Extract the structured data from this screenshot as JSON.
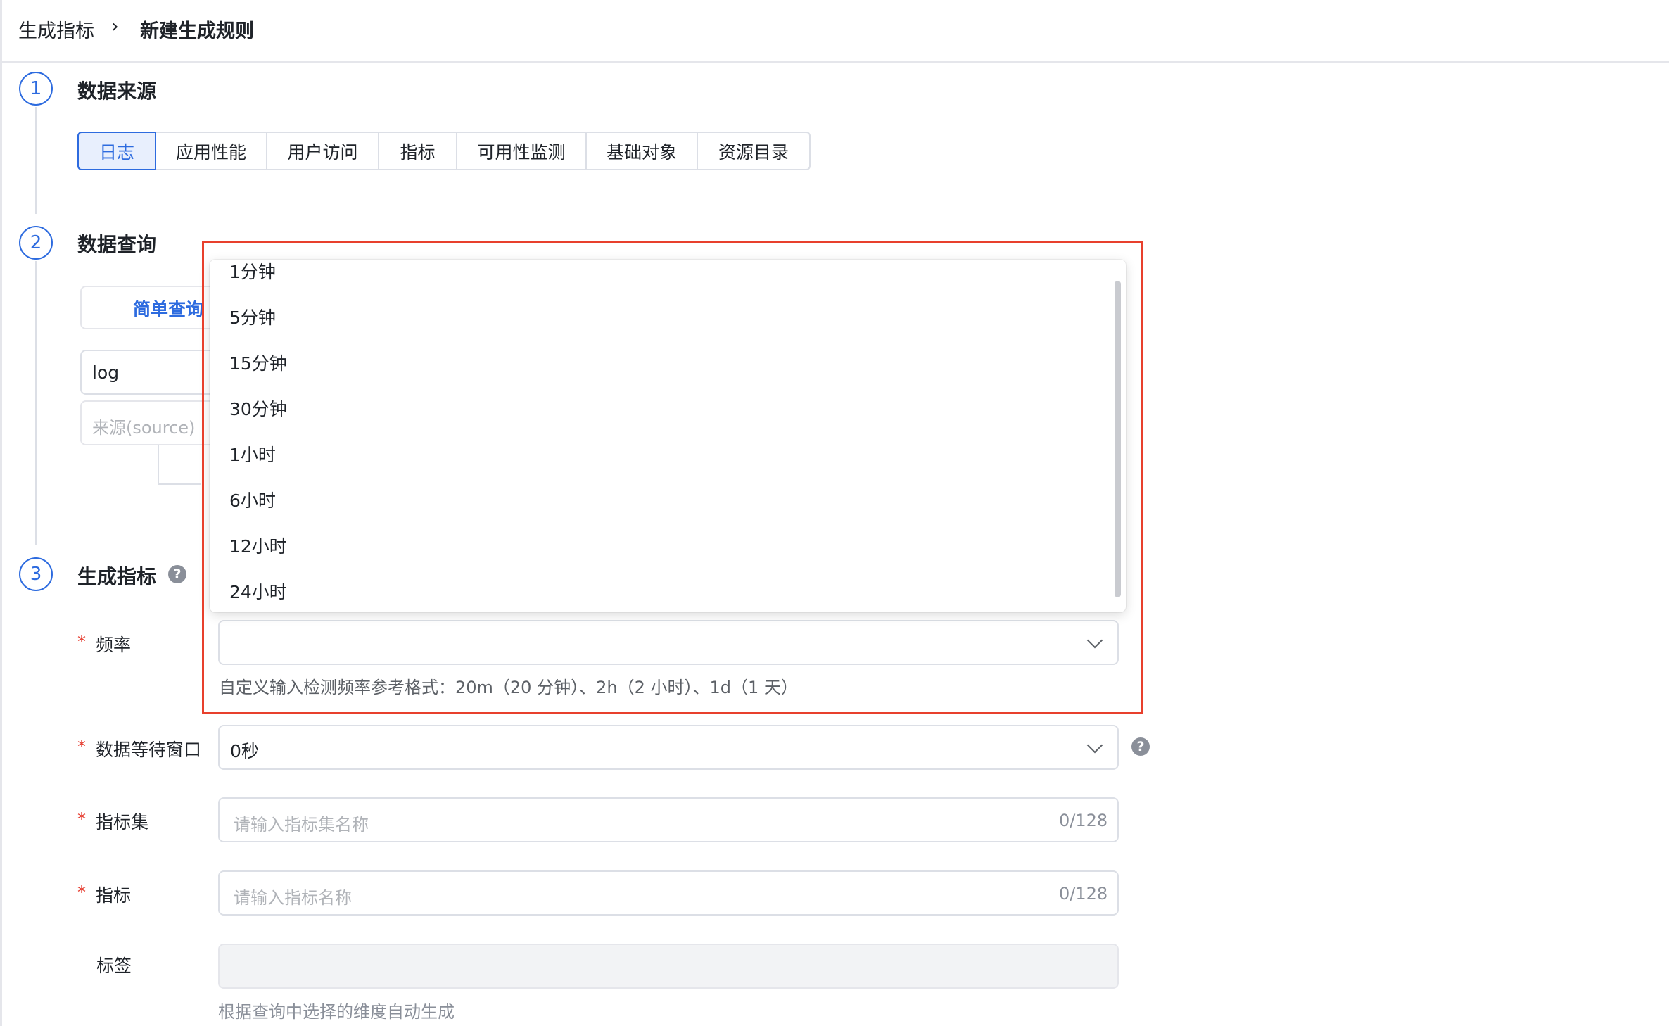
{
  "breadcrumb": {
    "root": "生成指标",
    "separator": "›",
    "current": "新建生成规则"
  },
  "steps": [
    {
      "number": "1",
      "title": "数据来源"
    },
    {
      "number": "2",
      "title": "数据查询"
    },
    {
      "number": "3",
      "title": "生成指标"
    }
  ],
  "source_tabs": [
    {
      "label": "日志",
      "active": true
    },
    {
      "label": "应用性能",
      "active": false
    },
    {
      "label": "用户访问",
      "active": false
    },
    {
      "label": "指标",
      "active": false
    },
    {
      "label": "可用性监测",
      "active": false
    },
    {
      "label": "基础对象",
      "active": false
    },
    {
      "label": "资源目录",
      "active": false
    }
  ],
  "query": {
    "mode_tab": "简单查询",
    "data_source_value": "log",
    "source_placeholder": "来源(source)"
  },
  "help_icon_char": "?",
  "form": {
    "frequency": {
      "label": "频率",
      "value": "",
      "hint": "自定义输入检测频率参考格式：20m（20 分钟）、2h（2 小时）、1d（1 天）",
      "options": [
        "1分钟",
        "5分钟",
        "15分钟",
        "30分钟",
        "1小时",
        "6小时",
        "12小时",
        "24小时"
      ]
    },
    "wait_window": {
      "label": "数据等待窗口",
      "value": "0秒"
    },
    "metric_set": {
      "label": "指标集",
      "placeholder": "请输入指标集名称",
      "counter": "0/128"
    },
    "metric": {
      "label": "指标",
      "placeholder": "请输入指标名称",
      "counter": "0/128"
    },
    "tags": {
      "label": "标签",
      "hint": "根据查询中选择的维度自动生成"
    },
    "required_mark": "*"
  },
  "colors": {
    "accent": "#2d6bdf",
    "highlight": "#e8402d",
    "required": "#e63f32"
  }
}
